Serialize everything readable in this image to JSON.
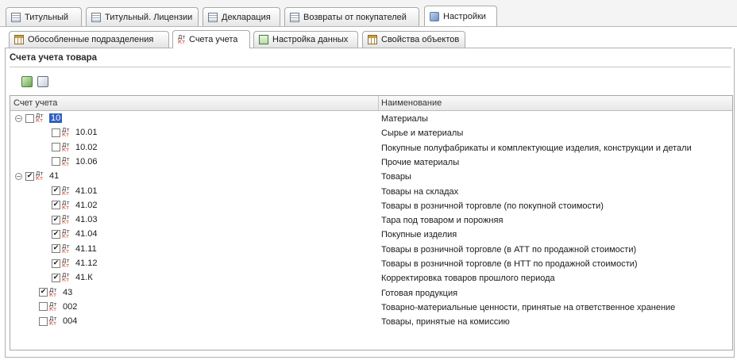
{
  "top_tabs": [
    {
      "label": "Титульный",
      "icon": "doc-icon"
    },
    {
      "label": "Титульный. Лицензии",
      "icon": "doc-icon"
    },
    {
      "label": "Декларация",
      "icon": "doc-icon"
    },
    {
      "label": "Возвраты от покупателей",
      "icon": "doc-icon"
    },
    {
      "label": "Настройки",
      "icon": "settings-icon",
      "active": true
    }
  ],
  "sub_tabs": [
    {
      "label": "Обособленные подразделения",
      "icon": "table-icon"
    },
    {
      "label": "Счета учета",
      "icon": "account-icon",
      "active": true
    },
    {
      "label": "Настройка данных",
      "icon": "data-settings-icon"
    },
    {
      "label": "Свойства объектов",
      "icon": "table-icon"
    }
  ],
  "section": {
    "title": "Счета учета товара"
  },
  "toolbar": {
    "check_all_icon": "check-all-icon",
    "uncheck_all_icon": "uncheck-all-icon"
  },
  "table": {
    "columns": [
      "Счет учета",
      "Наименование"
    ],
    "rows": [
      {
        "code": "10",
        "name": "Материалы",
        "checked": false,
        "level": 0,
        "group": true,
        "selected": true
      },
      {
        "code": "10.01",
        "name": "Сырье и материалы",
        "checked": false,
        "level": 1
      },
      {
        "code": "10.02",
        "name": "Покупные полуфабрикаты и комплектующие изделия, конструкции и детали",
        "checked": false,
        "level": 1
      },
      {
        "code": "10.06",
        "name": "Прочие материалы",
        "checked": false,
        "level": 1
      },
      {
        "code": "41",
        "name": "Товары",
        "checked": true,
        "level": 0,
        "group": true
      },
      {
        "code": "41.01",
        "name": "Товары на складах",
        "checked": true,
        "level": 1
      },
      {
        "code": "41.02",
        "name": "Товары в розничной торговле (по покупной стоимости)",
        "checked": true,
        "level": 1
      },
      {
        "code": "41.03",
        "name": "Тара под товаром и порожняя",
        "checked": true,
        "level": 1
      },
      {
        "code": "41.04",
        "name": "Покупные изделия",
        "checked": true,
        "level": 1
      },
      {
        "code": "41.11",
        "name": "Товары в розничной торговле (в АТТ по продажной стоимости)",
        "checked": true,
        "level": 1
      },
      {
        "code": "41.12",
        "name": "Товары в розничной торговле (в НТТ по продажной стоимости)",
        "checked": true,
        "level": 1
      },
      {
        "code": "41.К",
        "name": "Корректировка товаров прошлого периода",
        "checked": true,
        "level": 1
      },
      {
        "code": "43",
        "name": "Готовая продукция",
        "checked": true,
        "level": 0
      },
      {
        "code": "002",
        "name": "Товарно-материальные ценности, принятые на ответственное хранение",
        "checked": false,
        "level": 0
      },
      {
        "code": "004",
        "name": "Товары, принятые на комиссию",
        "checked": false,
        "level": 0
      }
    ]
  }
}
